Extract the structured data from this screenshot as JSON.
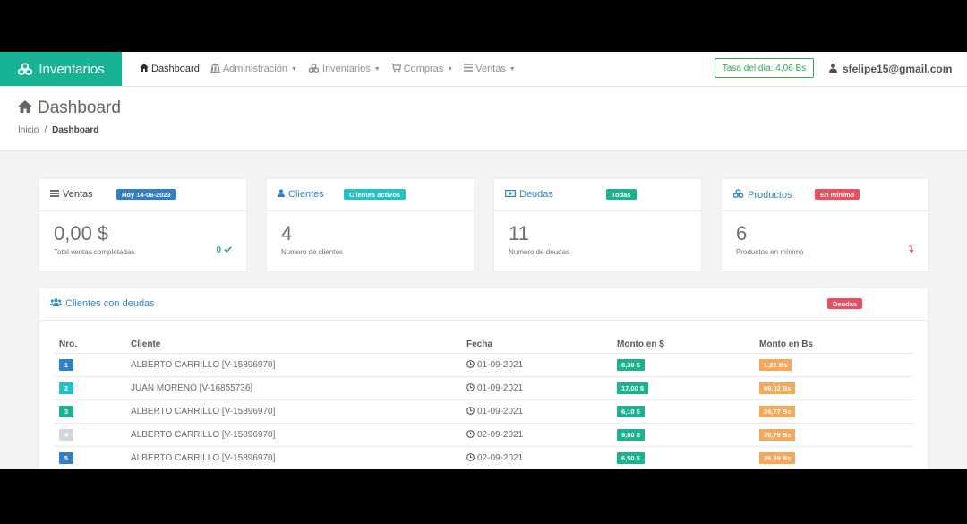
{
  "navbar": {
    "brand": "Inventarios",
    "items": [
      {
        "label": "Dashboard",
        "icon": "home-icon",
        "active": true,
        "dropdown": false
      },
      {
        "label": "Administración",
        "icon": "bank-icon",
        "active": false,
        "dropdown": true
      },
      {
        "label": "Inventarios",
        "icon": "cubes-icon",
        "active": false,
        "dropdown": true
      },
      {
        "label": "Compras",
        "icon": "cart-icon",
        "active": false,
        "dropdown": true
      },
      {
        "label": "Ventas",
        "icon": "list-icon",
        "active": false,
        "dropdown": true
      }
    ],
    "rate": "Tasa del día: 4,06 Bs",
    "user": "sfelipe15@gmail.com"
  },
  "page": {
    "title": "Dashboard",
    "breadcrumb": [
      "Inicio",
      "Dashboard"
    ]
  },
  "cards": [
    {
      "title": "Ventas",
      "icon": "bars-icon",
      "title_color": "#3a3f44",
      "badge": "Hoy 14-06-2023",
      "badge_color": "#2f7fc7",
      "value": "0,00 $",
      "label": "Total ventas completadas",
      "indicator": "0",
      "indicator_icon": "check-icon",
      "indicator_color": "#1fa6a0"
    },
    {
      "title": "Clientes",
      "icon": "user-icon",
      "title_color": "#2f86c8",
      "badge": "Clientes activos",
      "badge_color": "#23c0c6",
      "value": "4",
      "label": "Numero de clientes",
      "indicator": "",
      "indicator_icon": "",
      "indicator_color": ""
    },
    {
      "title": "Deudas",
      "icon": "money-icon",
      "title_color": "#2f86c8",
      "badge": "Todas",
      "badge_color": "#1bb28f",
      "value": "11",
      "label": "Numero de deudas",
      "indicator": "",
      "indicator_icon": "",
      "indicator_color": ""
    },
    {
      "title": "Productos",
      "icon": "cubes-icon",
      "title_color": "#2f86c8",
      "badge": "En mínimo",
      "badge_color": "#e94f5f",
      "value": "6",
      "label": "Productos en mínimo",
      "indicator": "",
      "indicator_icon": "down-arrow-icon",
      "indicator_color": "#e94f5f"
    }
  ],
  "debts": {
    "title": "Clientes con deudas",
    "badge": "Deudas",
    "columns": [
      "Nro.",
      "Cliente",
      "Fecha",
      "Monto en $",
      "Monto en Bs"
    ],
    "rows": [
      {
        "nro": "1",
        "nro_color": "#2f7fc7",
        "cliente": "ALBERTO CARRILLO [V-15896970]",
        "fecha": "01-09-2021",
        "usd": "0,30 $",
        "bs": "1,22 Bs"
      },
      {
        "nro": "2",
        "nro_color": "#23c0c6",
        "cliente": "JUAN MORENO [V-16855736]",
        "fecha": "01-09-2021",
        "usd": "17,00 $",
        "bs": "69,02 Bs"
      },
      {
        "nro": "3",
        "nro_color": "#1bb28f",
        "cliente": "ALBERTO CARRILLO [V-15896970]",
        "fecha": "01-09-2021",
        "usd": "6,10 $",
        "bs": "24,77 Bs"
      },
      {
        "nro": "4",
        "nro_color": "#cfd6dc",
        "cliente": "ALBERTO CARRILLO [V-15896970]",
        "fecha": "02-09-2021",
        "usd": "9,80 $",
        "bs": "39,79 Bs"
      },
      {
        "nro": "5",
        "nro_color": "#2f7fc7",
        "cliente": "ALBERTO CARRILLO [V-15896970]",
        "fecha": "02-09-2021",
        "usd": "6,50 $",
        "bs": "26,39 Bs"
      }
    ],
    "usd_color": "#1bb28f",
    "bs_color": "#f5a75a"
  }
}
